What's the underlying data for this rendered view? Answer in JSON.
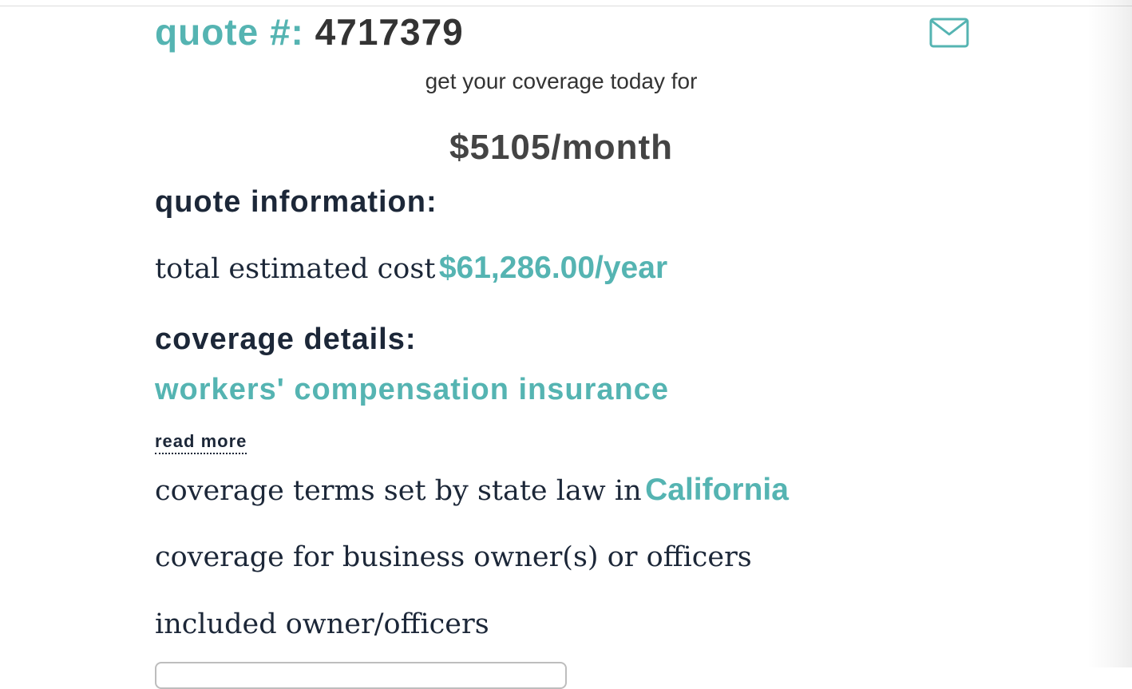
{
  "quote": {
    "label": "quote #:",
    "number": "4717379"
  },
  "header": {
    "email_icon": "envelope-icon",
    "accent_color": "#55b4b2"
  },
  "coverage_today": "get your coverage today for",
  "monthly_price": "$5105/month",
  "quote_information": {
    "heading": "quote information:",
    "total_label": "total estimated cost",
    "total_value": "$61,286.00/year"
  },
  "coverage_details": {
    "heading": "coverage details:",
    "product": "workers' compensation insurance",
    "read_more": "read more",
    "state_prefix": "coverage terms set by state law in",
    "state": "California",
    "owners_coverage": "coverage for business owner(s) or officers",
    "included_label": "included owner/officers"
  }
}
